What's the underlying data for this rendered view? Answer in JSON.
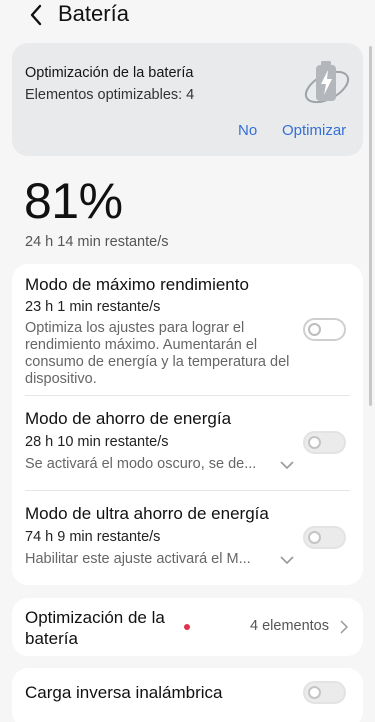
{
  "header": {
    "title": "Batería",
    "back_icon": "chevron-left-icon"
  },
  "optimization_card": {
    "title": "Optimización de la batería",
    "subtitle": "Elementos optimizables: 4",
    "icon": "battery-charging-icon",
    "no_label": "No",
    "optimize_label": "Optimizar",
    "accent_color": "#3470d6"
  },
  "battery": {
    "percent": "81%",
    "remaining": "24 h 14 min restante/s"
  },
  "modes": [
    {
      "title": "Modo de máximo rendimiento",
      "time": "23 h 1 min restante/s",
      "description": "Optimiza los ajustes para lograr el rendimiento máximo. Aumentarán el consumo de energía y la temperatura del dispositivo.",
      "enabled": false
    },
    {
      "title": "Modo de ahorro de energía",
      "time": "28 h 10 min restante/s",
      "description": "Se activará el modo oscuro, se de...",
      "enabled": false
    },
    {
      "title": "Modo de ultra ahorro de energía",
      "time": "74 h 9 min restante/s",
      "description": "Habilitar este ajuste activará el M...",
      "enabled": false
    }
  ],
  "battery_optimization_row": {
    "title": "Optimización de la batería",
    "count": "4 elementos",
    "badge_color": "#e0334a"
  },
  "reverse_charging": {
    "title": "Carga inversa inalámbrica",
    "enabled": false
  }
}
